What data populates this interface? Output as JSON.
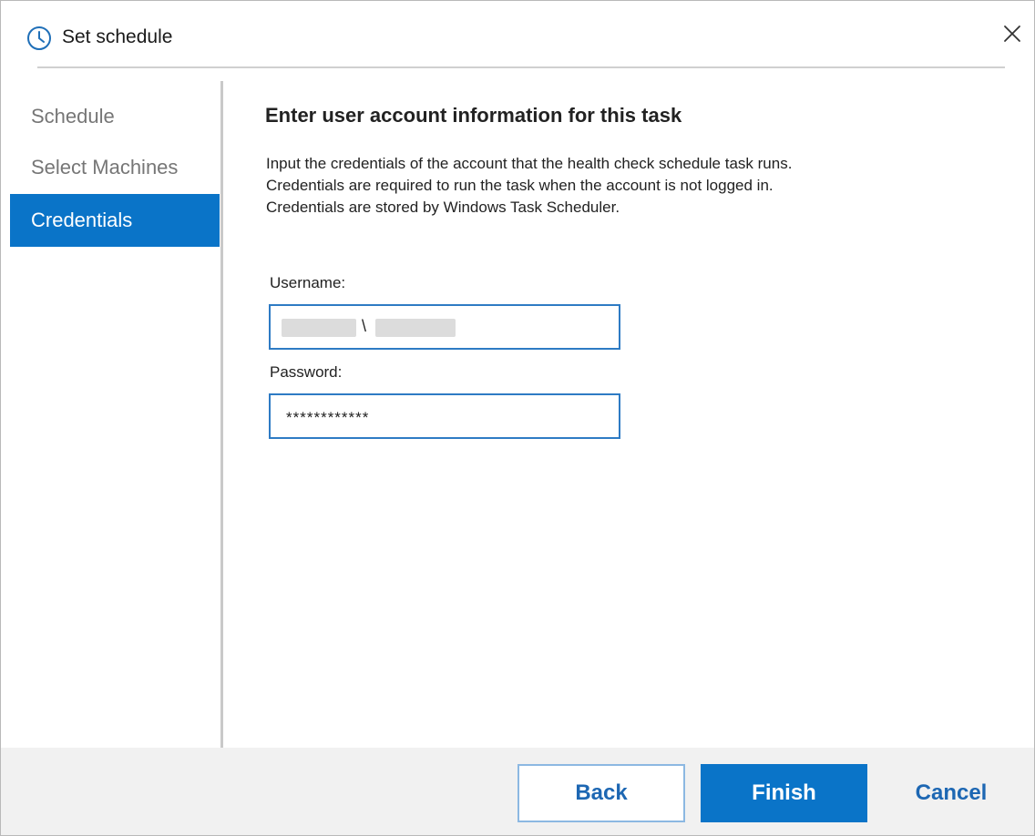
{
  "window": {
    "title": "Set schedule",
    "title_icon": "clock-icon",
    "close_icon": "close-icon"
  },
  "sidebar": {
    "items": [
      {
        "label": "Schedule",
        "active": false
      },
      {
        "label": "Select Machines",
        "active": false
      },
      {
        "label": "Credentials",
        "active": true
      }
    ]
  },
  "content": {
    "heading": "Enter user account information for this task",
    "description": [
      "Input the credentials of the account that the health check schedule task runs.",
      "Credentials are required to run the task when the account is not logged in.",
      "Credentials are stored by Windows Task Scheduler."
    ],
    "username": {
      "label": "Username:",
      "separator": "\\"
    },
    "password": {
      "label": "Password:",
      "value": "************"
    }
  },
  "footer": {
    "back_label": "Back",
    "finish_label": "Finish",
    "cancel_label": "Cancel"
  },
  "colors": {
    "accent": "#0a74c8",
    "link_text": "#1d67b3",
    "input_border": "#2e7bc4",
    "footer_bg": "#f1f1f1"
  }
}
